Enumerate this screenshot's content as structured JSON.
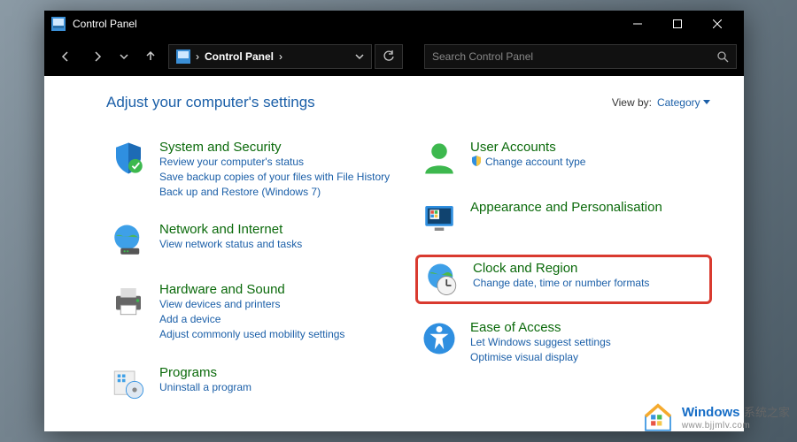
{
  "window": {
    "title": "Control Panel"
  },
  "breadcrumb": {
    "root": "Control Panel",
    "sep": "›"
  },
  "search": {
    "placeholder": "Search Control Panel"
  },
  "header": {
    "adjust": "Adjust your computer's settings",
    "viewby_label": "View by:",
    "viewby_value": "Category"
  },
  "left": [
    {
      "title": "System and Security",
      "links": [
        "Review your computer's status",
        "Save backup copies of your files with File History",
        "Back up and Restore (Windows 7)"
      ]
    },
    {
      "title": "Network and Internet",
      "links": [
        "View network status and tasks"
      ]
    },
    {
      "title": "Hardware and Sound",
      "links": [
        "View devices and printers",
        "Add a device",
        "Adjust commonly used mobility settings"
      ]
    },
    {
      "title": "Programs",
      "links": [
        "Uninstall a program"
      ]
    }
  ],
  "right": [
    {
      "title": "User Accounts",
      "links": [
        "Change account type"
      ],
      "shield": true
    },
    {
      "title": "Appearance and Personalisation",
      "links": []
    },
    {
      "title": "Clock and Region",
      "links": [
        "Change date, time or number formats"
      ],
      "highlight": true
    },
    {
      "title": "Ease of Access",
      "links": [
        "Let Windows suggest settings",
        "Optimise visual display"
      ]
    }
  ],
  "watermark": {
    "brand": "Windows",
    "cn": "系统之家",
    "url": "www.bjjmlv.com"
  }
}
